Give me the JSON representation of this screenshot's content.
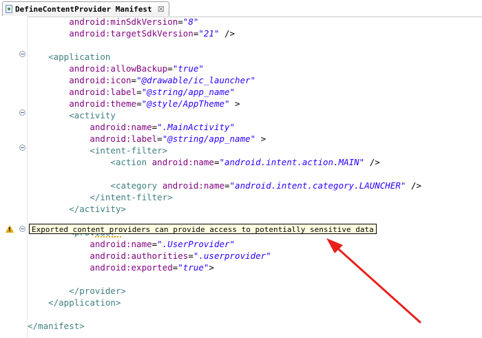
{
  "tab": {
    "title": "DefineContentProvider Manifest",
    "close_glyph": "☒"
  },
  "tooltip": {
    "text": "Exported content providers can provide access to potentially sensitive data"
  },
  "code_lines": [
    {
      "p": [
        "        ",
        "android:minSdkVersion",
        "=",
        "\"8\""
      ]
    },
    {
      "p": [
        "        ",
        "android:targetSdkVersion",
        "=",
        "\"21\"",
        " />"
      ]
    },
    {
      "p": [
        ""
      ]
    },
    {
      "p": [
        "    ",
        "<application"
      ]
    },
    {
      "p": [
        "        ",
        "android:allowBackup",
        "=",
        "\"true\""
      ]
    },
    {
      "p": [
        "        ",
        "android:icon",
        "=",
        "\"@drawable/ic_launcher\""
      ]
    },
    {
      "p": [
        "        ",
        "android:label",
        "=",
        "\"@string/app_name\""
      ]
    },
    {
      "p": [
        "        ",
        "android:theme",
        "=",
        "\"@style/AppTheme\"",
        " >"
      ]
    },
    {
      "p": [
        "        ",
        "<activity"
      ]
    },
    {
      "p": [
        "            ",
        "android:name",
        "=",
        "\".MainActivity\""
      ]
    },
    {
      "p": [
        "            ",
        "android:label",
        "=",
        "\"@string/app_name\"",
        " >"
      ]
    },
    {
      "p": [
        "            ",
        "<intent-filter>"
      ]
    },
    {
      "p": [
        "                ",
        "<action ",
        "android:name",
        "=",
        "\"android.intent.action.MAIN\"",
        " />"
      ]
    },
    {
      "p": [
        ""
      ]
    },
    {
      "p": [
        "                ",
        "<category ",
        "android:name",
        "=",
        "\"android.intent.category.LAUNCHER\"",
        " />"
      ]
    },
    {
      "p": [
        "            ",
        "</intent-filter>"
      ]
    },
    {
      "p": [
        "        ",
        "</activity>"
      ]
    },
    {
      "p": [
        ""
      ]
    },
    {
      "p": [
        "        ",
        "<provider"
      ]
    },
    {
      "p": [
        "            ",
        "android:name",
        "=",
        "\".UserProvider\""
      ]
    },
    {
      "p": [
        "            ",
        "android:authorities",
        "=",
        "\".userprovider\""
      ]
    },
    {
      "p": [
        "            ",
        "android:exported",
        "=",
        "\"true\"",
        ">"
      ]
    },
    {
      "p": [
        ""
      ]
    },
    {
      "p": [
        "        ",
        "</provider>"
      ]
    },
    {
      "p": [
        "    ",
        "</application>"
      ]
    },
    {
      "p": [
        ""
      ]
    },
    {
      "p": [
        "</manifest>"
      ]
    }
  ],
  "colors": {
    "tag": "#3f7f7f",
    "attribute": "#7f007f",
    "value": "#2a00ff",
    "arrow": "#e8201c",
    "warning": "#e0a800"
  }
}
